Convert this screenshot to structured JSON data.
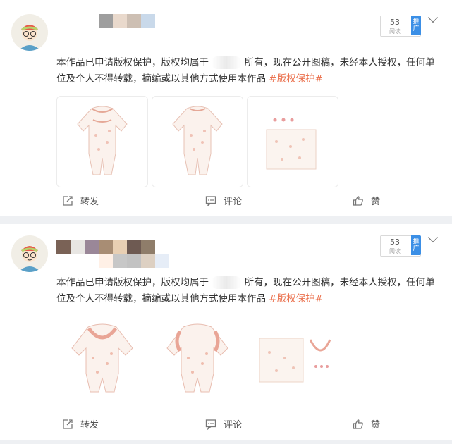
{
  "posts": [
    {
      "post_text_before": "本作品已申请版权保护，版权均属于",
      "post_text_after": "所有，现在公开图稿，未经本人授权，任何单位及个人不得转载，摘编或以其他方式使用本作品",
      "topic": "#版权保护#",
      "views": {
        "count": "53",
        "label": "阅读",
        "promote": "推广"
      },
      "actions": {
        "repost": "转发",
        "comment": "评论",
        "like": "赞"
      }
    },
    {
      "post_text_before": "本作品已申请版权保护，版权均属于",
      "post_text_after": "所有，现在公开图稿，未经本人授权，任何单位及个人不得转载，摘编或以其他方式使用本作品",
      "topic": "#版权保护#",
      "views": {
        "count": "53",
        "label": "阅读",
        "promote": "推广"
      },
      "actions": {
        "repost": "转发",
        "comment": "评论",
        "like": "赞"
      }
    }
  ],
  "colors": {
    "topic": "#eb7350",
    "promote": "#3b8fe6",
    "text": "#333333",
    "muted": "#555555"
  },
  "icons": [
    "avatar-illustration",
    "chevron-down-icon",
    "repost-icon",
    "comment-icon",
    "like-icon"
  ]
}
